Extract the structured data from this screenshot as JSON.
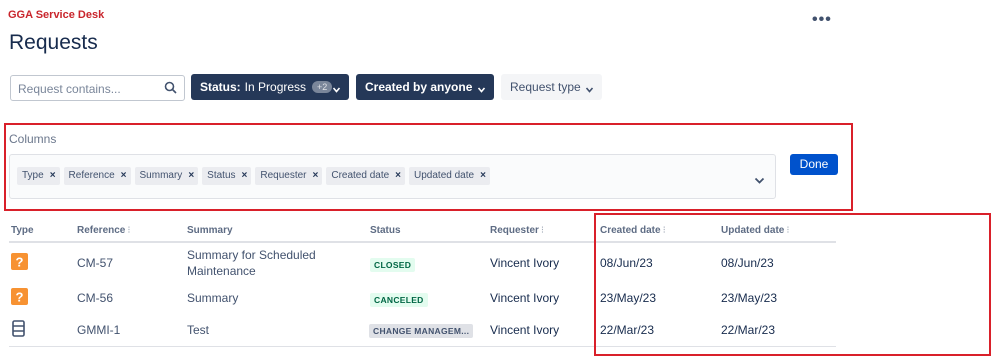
{
  "app_name": "GGA Service Desk",
  "page_title": "Requests",
  "more_icon": "•••",
  "search": {
    "placeholder": "Request contains..."
  },
  "filters": {
    "status_label": "Status:",
    "status_value": "In Progress",
    "status_count": "+2",
    "creator": "Created by anyone",
    "type": "Request type"
  },
  "columns": {
    "label": "Columns",
    "selected": [
      "Type",
      "Reference",
      "Summary",
      "Status",
      "Requester",
      "Created date",
      "Updated date"
    ],
    "done_label": "Done"
  },
  "table": {
    "headers": {
      "type": "Type",
      "reference": "Reference",
      "summary": "Summary",
      "status": "Status",
      "requester": "Requester",
      "created": "Created date",
      "updated": "Updated date"
    },
    "rows": [
      {
        "type_icon": "question-icon",
        "reference": "CM-57",
        "summary_line1": "Summary for Scheduled",
        "summary_line2": "Maintenance",
        "status": "CLOSED",
        "requester": "Vincent Ivory",
        "created": "08/Jun/23",
        "updated": "08/Jun/23"
      },
      {
        "type_icon": "question-icon",
        "reference": "CM-56",
        "summary_line1": "Summary",
        "status": "CANCELED",
        "requester": "Vincent Ivory",
        "created": "23/May/23",
        "updated": "23/May/23"
      },
      {
        "type_icon": "server-icon",
        "reference": "GMMI-1",
        "summary_line1": "Test",
        "status": "CHANGE MANAGEM...",
        "requester": "Vincent Ivory",
        "created": "22/Mar/23",
        "updated": "22/Mar/23"
      }
    ]
  },
  "colors": {
    "brand_red": "#c9252c",
    "filter_dark": "#253858",
    "primary_blue": "#0052cc",
    "icon_orange": "#f79232",
    "highlight_red": "#d9202a"
  }
}
